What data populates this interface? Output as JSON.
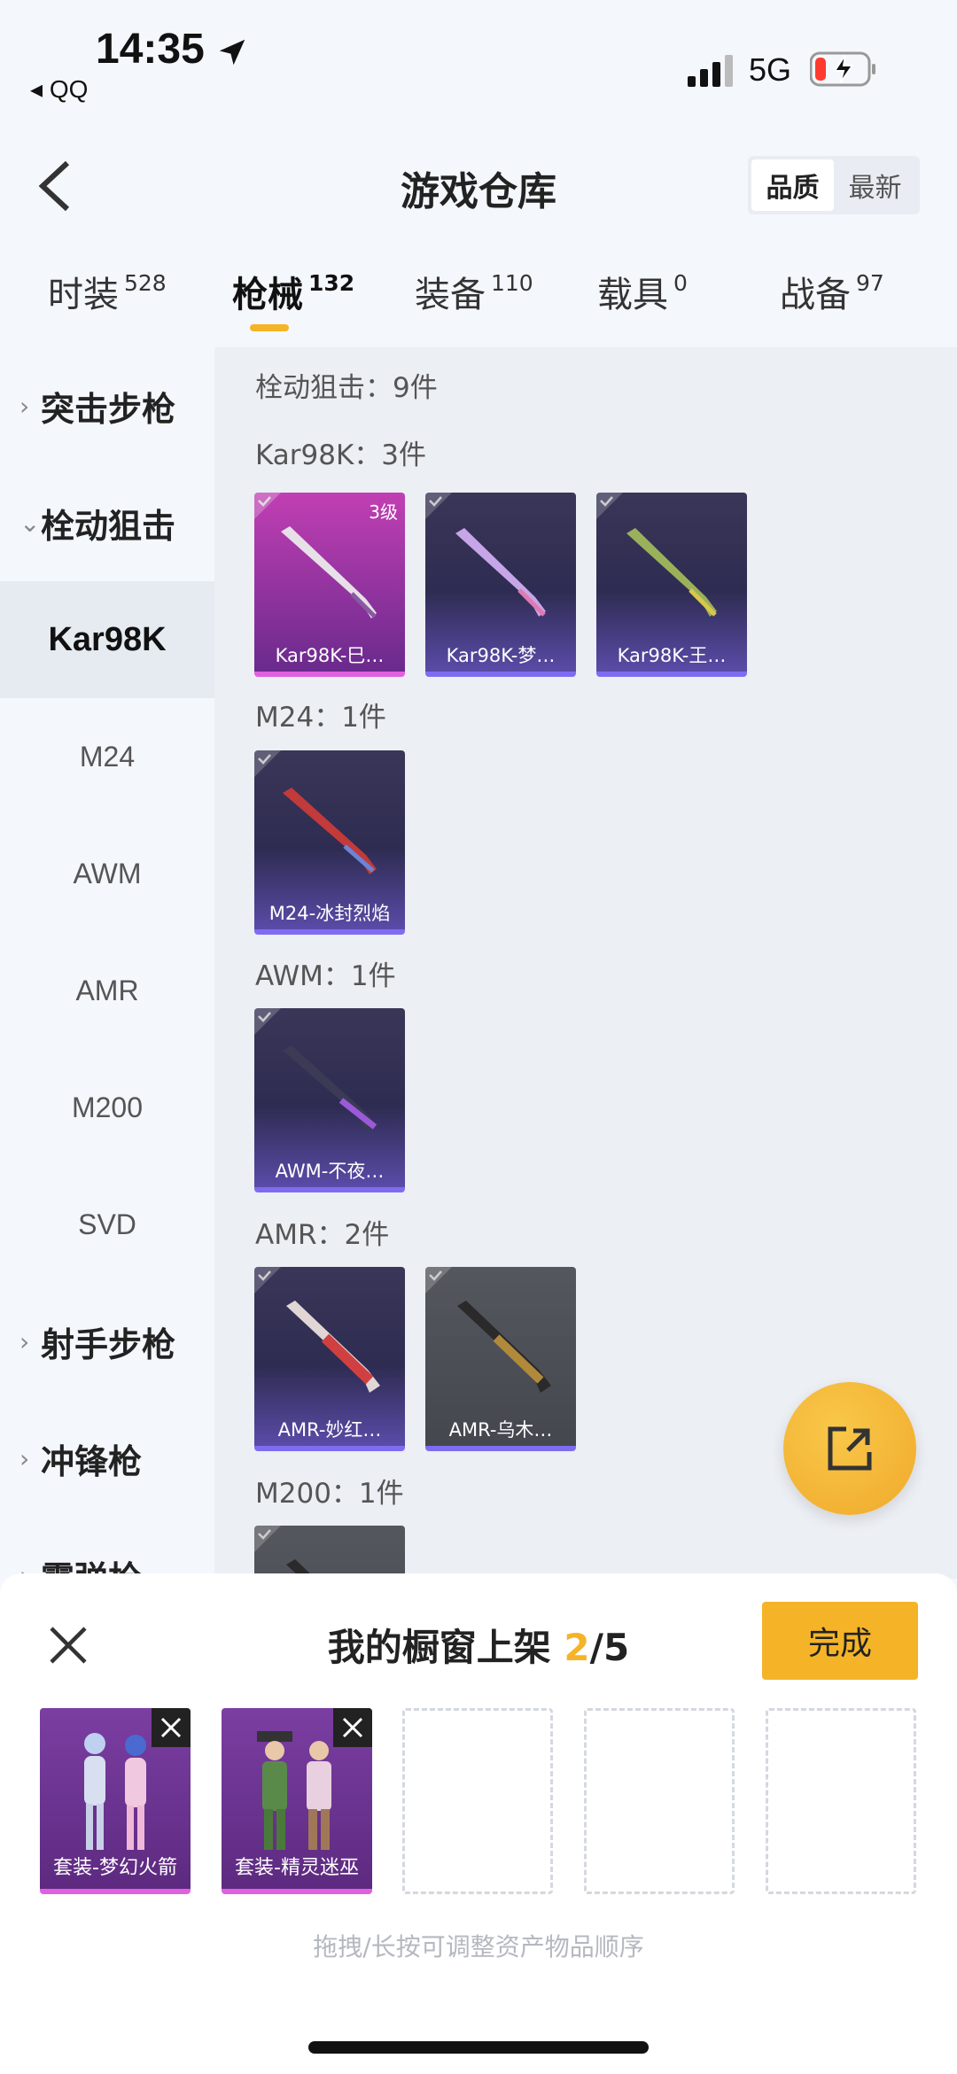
{
  "status_bar": {
    "time": "14:35",
    "back_app": "◂ QQ",
    "network": "5G"
  },
  "header": {
    "title": "游戏仓库",
    "sort_options": [
      "品质",
      "最新"
    ]
  },
  "tabs": [
    {
      "label": "时装",
      "count": "528"
    },
    {
      "label": "枪械",
      "count": "132"
    },
    {
      "label": "装备",
      "count": "110"
    },
    {
      "label": "载具",
      "count": "0"
    },
    {
      "label": "战备",
      "count": "97"
    }
  ],
  "sidebar": {
    "categories": [
      {
        "label": "突击步枪",
        "expanded": false
      },
      {
        "label": "栓动狙击",
        "expanded": true
      },
      {
        "label": "射手步枪",
        "expanded": false
      },
      {
        "label": "冲锋枪",
        "expanded": false
      },
      {
        "label": "霰弹枪",
        "expanded": false
      }
    ],
    "sub_items": [
      "Kar98K",
      "M24",
      "AWM",
      "AMR",
      "M200",
      "SVD"
    ]
  },
  "main": {
    "section_title": "栓动狙击：9件",
    "groups": [
      {
        "title": "Kar98K：3件",
        "items": [
          {
            "name": "Kar98K-巳…",
            "level": "3级",
            "style": "purple"
          },
          {
            "name": "Kar98K-梦…",
            "style": "blue"
          },
          {
            "name": "Kar98K-王…",
            "style": "blue"
          }
        ]
      },
      {
        "title": "M24：1件",
        "items": [
          {
            "name": "M24-冰封烈焰",
            "style": "blue"
          }
        ]
      },
      {
        "title": "AWM：1件",
        "items": [
          {
            "name": "AWM-不夜…",
            "style": "blue"
          }
        ]
      },
      {
        "title": "AMR：2件",
        "items": [
          {
            "name": "AMR-妙红…",
            "style": "blue"
          },
          {
            "name": "AMR-乌木…",
            "style": "gray"
          }
        ]
      },
      {
        "title": "M200：1件",
        "items": [
          {
            "name": "",
            "style": "gray"
          }
        ]
      }
    ]
  },
  "sheet": {
    "title_prefix": "我的橱窗上架 ",
    "current": "2",
    "total": "/5",
    "done_label": "完成",
    "slots": [
      {
        "name": "套装-梦幻火箭"
      },
      {
        "name": "套装-精灵迷巫"
      }
    ],
    "hint": "拖拽/长按可调整资产物品顺序"
  },
  "colors": {
    "accent": "#f5b428",
    "purple_card": "#c13fb3",
    "blue_card": "#2e2c52"
  }
}
